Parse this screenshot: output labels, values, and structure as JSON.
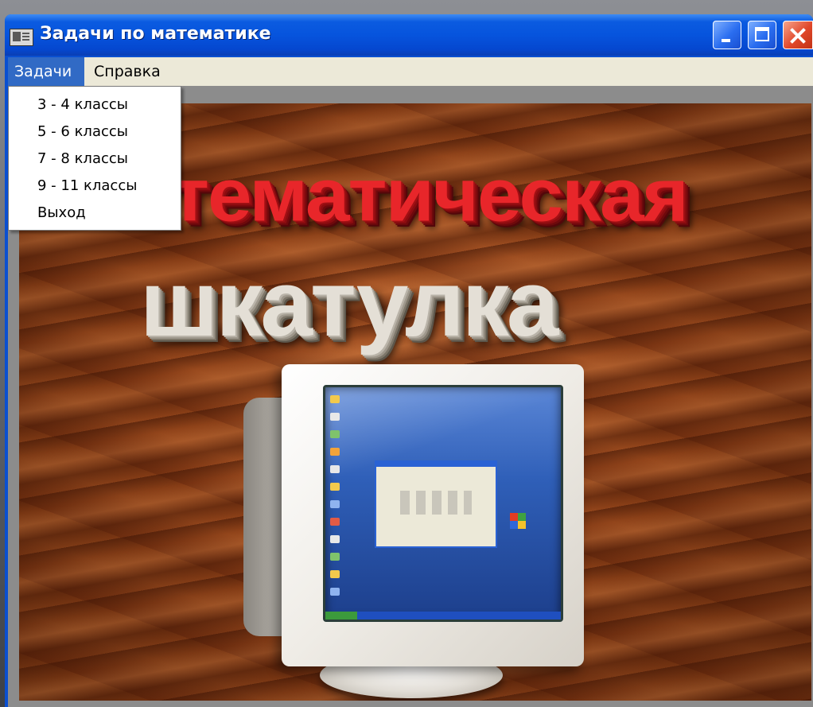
{
  "window": {
    "title": "Задачи по математике",
    "icon": "app-window-icon",
    "controls": {
      "minimize": "minimize-icon",
      "maximize": "maximize-icon",
      "close": "close-icon"
    }
  },
  "menubar": {
    "items": [
      {
        "label": "Задачи",
        "active": true
      },
      {
        "label": "Справка",
        "active": false
      }
    ]
  },
  "dropdown": {
    "items": [
      {
        "label": "3 - 4 классы"
      },
      {
        "label": "5 - 6 классы"
      },
      {
        "label": "7 - 8 классы"
      },
      {
        "label": "9 - 11 классы"
      },
      {
        "label": "Выход"
      }
    ]
  },
  "banner": {
    "line1": "тематическая",
    "line2": "шкатулка"
  },
  "colors": {
    "titlebar": "#0654dd",
    "menu_active": "#316ac5",
    "menubar_bg": "#ece9d8",
    "banner_line1": "#e8262a",
    "banner_line2": "#e4dfd6"
  }
}
